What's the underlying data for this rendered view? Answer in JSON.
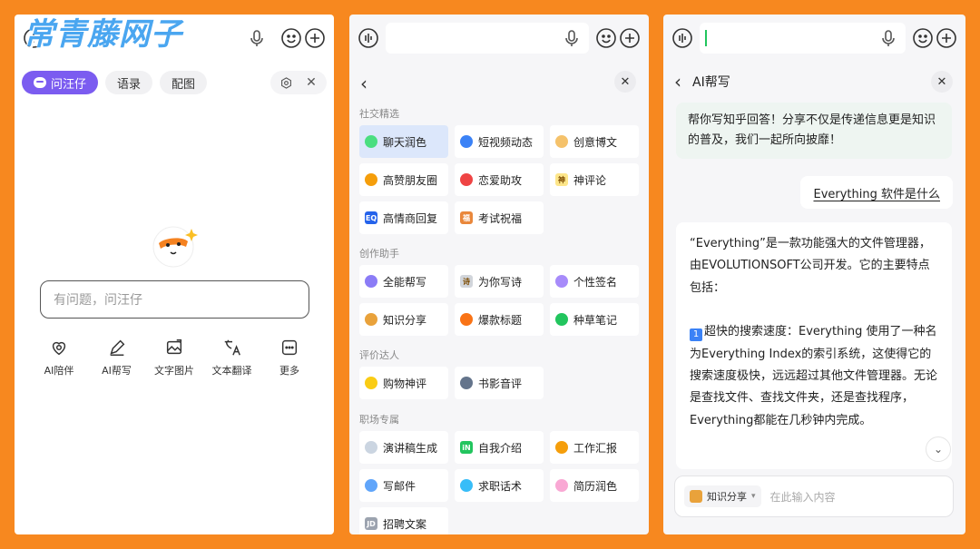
{
  "watermark": "常青藤网子",
  "panel1": {
    "tabs": [
      {
        "label": "问汪仔"
      },
      {
        "label": "语录"
      },
      {
        "label": "配图"
      }
    ],
    "ask_placeholder": "有问题，问汪仔",
    "features": [
      {
        "label": "AI陪伴",
        "icon": "heart-icon"
      },
      {
        "label": "AI帮写",
        "icon": "pen-icon"
      },
      {
        "label": "文字图片",
        "icon": "image-icon"
      },
      {
        "label": "文本翻译",
        "icon": "translate-icon"
      },
      {
        "label": "更多",
        "icon": "more-icon"
      }
    ]
  },
  "panel2": {
    "sections": [
      {
        "title": "社交精选",
        "items": [
          {
            "label": "聊天润色",
            "color": "#4ade80",
            "glyph": "",
            "selected": true
          },
          {
            "label": "短视频动态",
            "color": "#3b82f6",
            "glyph": ""
          },
          {
            "label": "创意博文",
            "color": "#f5c26b",
            "glyph": ""
          },
          {
            "label": "高赞朋友圈",
            "color": "#f59e0b",
            "glyph": ""
          },
          {
            "label": "恋爱助攻",
            "color": "#ef4444",
            "glyph": ""
          },
          {
            "label": "神评论",
            "color": "#fde68a",
            "glyph": "神"
          },
          {
            "label": "高情商回复",
            "color": "#2563eb",
            "glyph": "EQ"
          },
          {
            "label": "考试祝福",
            "color": "#e9873b",
            "glyph": "福"
          }
        ]
      },
      {
        "title": "创作助手",
        "items": [
          {
            "label": "全能帮写",
            "color": "#8b7cf6",
            "glyph": ""
          },
          {
            "label": "为你写诗",
            "color": "#d1d5db",
            "glyph": "诗"
          },
          {
            "label": "个性签名",
            "color": "#a78bfa",
            "glyph": ""
          },
          {
            "label": "知识分享",
            "color": "#e9a23b",
            "glyph": ""
          },
          {
            "label": "爆款标题",
            "color": "#f97316",
            "glyph": ""
          },
          {
            "label": "种草笔记",
            "color": "#22c55e",
            "glyph": ""
          }
        ]
      },
      {
        "title": "评价达人",
        "items": [
          {
            "label": "购物神评",
            "color": "#facc15",
            "glyph": ""
          },
          {
            "label": "书影音评",
            "color": "#64748b",
            "glyph": ""
          }
        ]
      },
      {
        "title": "职场专属",
        "items": [
          {
            "label": "演讲稿生成",
            "color": "#cbd5e1",
            "glyph": ""
          },
          {
            "label": "自我介绍",
            "color": "#22c55e",
            "glyph": "iN"
          },
          {
            "label": "工作汇报",
            "color": "#f59e0b",
            "glyph": ""
          },
          {
            "label": "写邮件",
            "color": "#60a5fa",
            "glyph": ""
          },
          {
            "label": "求职话术",
            "color": "#38bdf8",
            "glyph": ""
          },
          {
            "label": "简历润色",
            "color": "#f9a8d4",
            "glyph": ""
          },
          {
            "label": "招聘文案",
            "color": "#9ca3af",
            "glyph": "JD"
          }
        ]
      }
    ]
  },
  "panel3": {
    "title": "AI帮写",
    "intro": "帮你写知乎回答！分享不仅是传递信息更是知识的普及，我们一起所向披靡！",
    "user_message": "Everything 软件是什么",
    "answer_p1": "“Everything”是一款功能强大的文件管理器，由EVOLUTIONSOFT公司开发。它的主要特点包括：",
    "answer_num": "1",
    "answer_p2": "超快的搜索速度：Everything 使用了一种名为Everything Index的索引系统，这使得它的搜索速度极快，远远超过其他文件管理器。无论是查找文件、查找文件夹，还是查找程序，Everything都能在几秒钟内完成。",
    "chip_label": "知识分享",
    "compose_placeholder": "在此输入内容"
  }
}
